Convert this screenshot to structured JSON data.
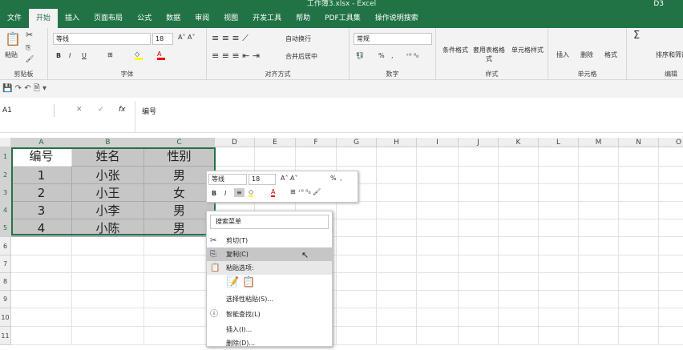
{
  "window": {
    "title": "工作簿3.xlsx - Excel",
    "user": "D3"
  },
  "tabs": [
    "文件",
    "开始",
    "插入",
    "页面布局",
    "公式",
    "数据",
    "审阅",
    "视图",
    "开发工具",
    "帮助",
    "PDF工具集"
  ],
  "tell_me": "操作说明搜索",
  "ribbon": {
    "clipboard": {
      "label": "剪贴板",
      "paste": "粘贴"
    },
    "font": {
      "label": "字体",
      "name": "等线",
      "size": "18",
      "bold": "B",
      "italic": "I",
      "underline": "U"
    },
    "alignment": {
      "label": "对齐方式",
      "wrap": "自动换行",
      "merge": "合并后居中"
    },
    "number": {
      "label": "数字",
      "format": "常规",
      "percent": "%",
      "comma": ","
    },
    "styles": {
      "label": "样式",
      "conditional": "条件格式",
      "table": "套用表格格式",
      "cell": "单元格样式"
    },
    "cells": {
      "label": "单元格",
      "insert": "插入",
      "delete": "删除",
      "format": "格式"
    },
    "editing": {
      "label": "编辑",
      "sort": "排序和筛选"
    }
  },
  "formula_bar": {
    "name_box": "A1",
    "fx": "fx",
    "content": "编号"
  },
  "columns": [
    "A",
    "B",
    "C",
    "D",
    "E",
    "F",
    "G",
    "H",
    "I",
    "J",
    "K",
    "L",
    "M",
    "N",
    "O"
  ],
  "rows": [
    "1",
    "2",
    "3",
    "4",
    "5",
    "6",
    "7",
    "8",
    "9",
    "10",
    "11"
  ],
  "table": [
    [
      "编号",
      "姓名",
      "性别"
    ],
    [
      "1",
      "小张",
      "男"
    ],
    [
      "2",
      "小王",
      "女"
    ],
    [
      "3",
      "小李",
      "男"
    ],
    [
      "4",
      "小陈",
      "男"
    ]
  ],
  "mini_toolbar": {
    "font": "等线",
    "size": "18",
    "bold": "B",
    "italic": "I",
    "percent": "%",
    "comma": ","
  },
  "context_menu": {
    "search": "搜索菜单",
    "items": [
      "剪切(T)",
      "复制(C)",
      "粘贴选项:",
      "选择性粘贴(S)...",
      "智能查找(L)",
      "插入(I)...",
      "删除(D)..."
    ]
  },
  "colors": {
    "accent": "#217346"
  }
}
